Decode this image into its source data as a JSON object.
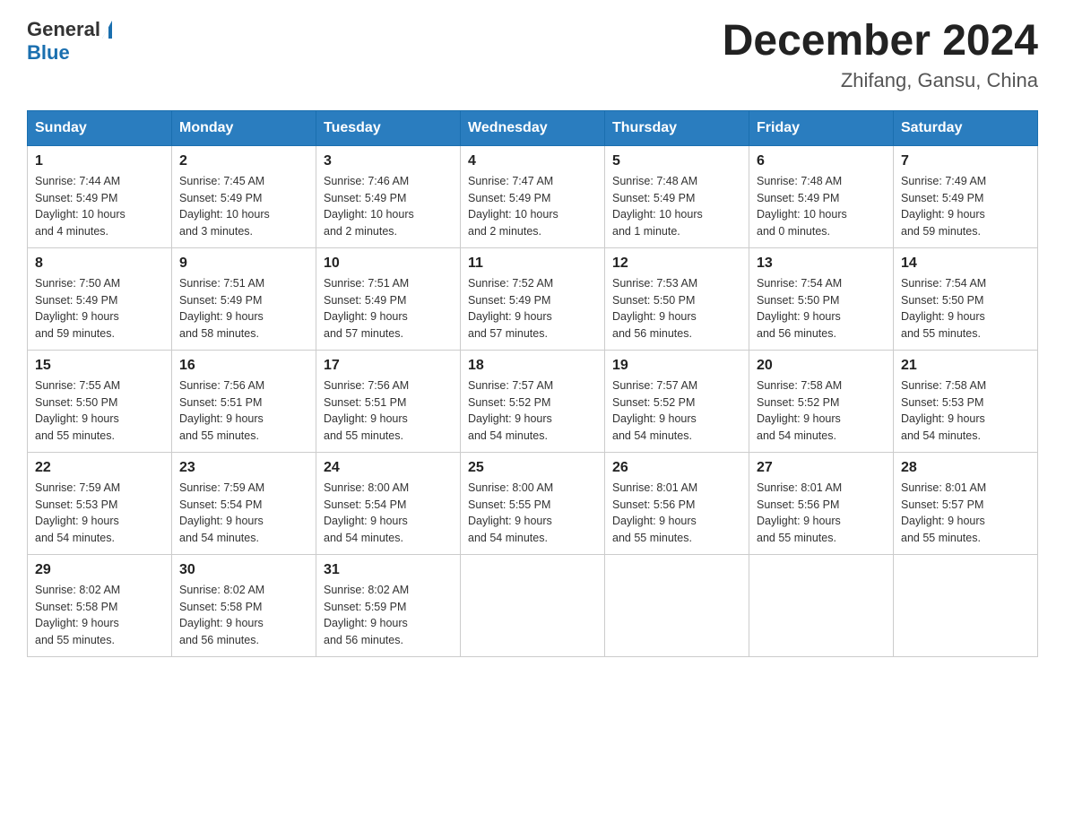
{
  "header": {
    "logo_general": "General",
    "logo_blue": "Blue",
    "month_title": "December 2024",
    "subtitle": "Zhifang, Gansu, China"
  },
  "weekdays": [
    "Sunday",
    "Monday",
    "Tuesday",
    "Wednesday",
    "Thursday",
    "Friday",
    "Saturday"
  ],
  "weeks": [
    [
      {
        "day": "1",
        "info": "Sunrise: 7:44 AM\nSunset: 5:49 PM\nDaylight: 10 hours\nand 4 minutes."
      },
      {
        "day": "2",
        "info": "Sunrise: 7:45 AM\nSunset: 5:49 PM\nDaylight: 10 hours\nand 3 minutes."
      },
      {
        "day": "3",
        "info": "Sunrise: 7:46 AM\nSunset: 5:49 PM\nDaylight: 10 hours\nand 2 minutes."
      },
      {
        "day": "4",
        "info": "Sunrise: 7:47 AM\nSunset: 5:49 PM\nDaylight: 10 hours\nand 2 minutes."
      },
      {
        "day": "5",
        "info": "Sunrise: 7:48 AM\nSunset: 5:49 PM\nDaylight: 10 hours\nand 1 minute."
      },
      {
        "day": "6",
        "info": "Sunrise: 7:48 AM\nSunset: 5:49 PM\nDaylight: 10 hours\nand 0 minutes."
      },
      {
        "day": "7",
        "info": "Sunrise: 7:49 AM\nSunset: 5:49 PM\nDaylight: 9 hours\nand 59 minutes."
      }
    ],
    [
      {
        "day": "8",
        "info": "Sunrise: 7:50 AM\nSunset: 5:49 PM\nDaylight: 9 hours\nand 59 minutes."
      },
      {
        "day": "9",
        "info": "Sunrise: 7:51 AM\nSunset: 5:49 PM\nDaylight: 9 hours\nand 58 minutes."
      },
      {
        "day": "10",
        "info": "Sunrise: 7:51 AM\nSunset: 5:49 PM\nDaylight: 9 hours\nand 57 minutes."
      },
      {
        "day": "11",
        "info": "Sunrise: 7:52 AM\nSunset: 5:49 PM\nDaylight: 9 hours\nand 57 minutes."
      },
      {
        "day": "12",
        "info": "Sunrise: 7:53 AM\nSunset: 5:50 PM\nDaylight: 9 hours\nand 56 minutes."
      },
      {
        "day": "13",
        "info": "Sunrise: 7:54 AM\nSunset: 5:50 PM\nDaylight: 9 hours\nand 56 minutes."
      },
      {
        "day": "14",
        "info": "Sunrise: 7:54 AM\nSunset: 5:50 PM\nDaylight: 9 hours\nand 55 minutes."
      }
    ],
    [
      {
        "day": "15",
        "info": "Sunrise: 7:55 AM\nSunset: 5:50 PM\nDaylight: 9 hours\nand 55 minutes."
      },
      {
        "day": "16",
        "info": "Sunrise: 7:56 AM\nSunset: 5:51 PM\nDaylight: 9 hours\nand 55 minutes."
      },
      {
        "day": "17",
        "info": "Sunrise: 7:56 AM\nSunset: 5:51 PM\nDaylight: 9 hours\nand 55 minutes."
      },
      {
        "day": "18",
        "info": "Sunrise: 7:57 AM\nSunset: 5:52 PM\nDaylight: 9 hours\nand 54 minutes."
      },
      {
        "day": "19",
        "info": "Sunrise: 7:57 AM\nSunset: 5:52 PM\nDaylight: 9 hours\nand 54 minutes."
      },
      {
        "day": "20",
        "info": "Sunrise: 7:58 AM\nSunset: 5:52 PM\nDaylight: 9 hours\nand 54 minutes."
      },
      {
        "day": "21",
        "info": "Sunrise: 7:58 AM\nSunset: 5:53 PM\nDaylight: 9 hours\nand 54 minutes."
      }
    ],
    [
      {
        "day": "22",
        "info": "Sunrise: 7:59 AM\nSunset: 5:53 PM\nDaylight: 9 hours\nand 54 minutes."
      },
      {
        "day": "23",
        "info": "Sunrise: 7:59 AM\nSunset: 5:54 PM\nDaylight: 9 hours\nand 54 minutes."
      },
      {
        "day": "24",
        "info": "Sunrise: 8:00 AM\nSunset: 5:54 PM\nDaylight: 9 hours\nand 54 minutes."
      },
      {
        "day": "25",
        "info": "Sunrise: 8:00 AM\nSunset: 5:55 PM\nDaylight: 9 hours\nand 54 minutes."
      },
      {
        "day": "26",
        "info": "Sunrise: 8:01 AM\nSunset: 5:56 PM\nDaylight: 9 hours\nand 55 minutes."
      },
      {
        "day": "27",
        "info": "Sunrise: 8:01 AM\nSunset: 5:56 PM\nDaylight: 9 hours\nand 55 minutes."
      },
      {
        "day": "28",
        "info": "Sunrise: 8:01 AM\nSunset: 5:57 PM\nDaylight: 9 hours\nand 55 minutes."
      }
    ],
    [
      {
        "day": "29",
        "info": "Sunrise: 8:02 AM\nSunset: 5:58 PM\nDaylight: 9 hours\nand 55 minutes."
      },
      {
        "day": "30",
        "info": "Sunrise: 8:02 AM\nSunset: 5:58 PM\nDaylight: 9 hours\nand 56 minutes."
      },
      {
        "day": "31",
        "info": "Sunrise: 8:02 AM\nSunset: 5:59 PM\nDaylight: 9 hours\nand 56 minutes."
      },
      {
        "day": "",
        "info": ""
      },
      {
        "day": "",
        "info": ""
      },
      {
        "day": "",
        "info": ""
      },
      {
        "day": "",
        "info": ""
      }
    ]
  ]
}
